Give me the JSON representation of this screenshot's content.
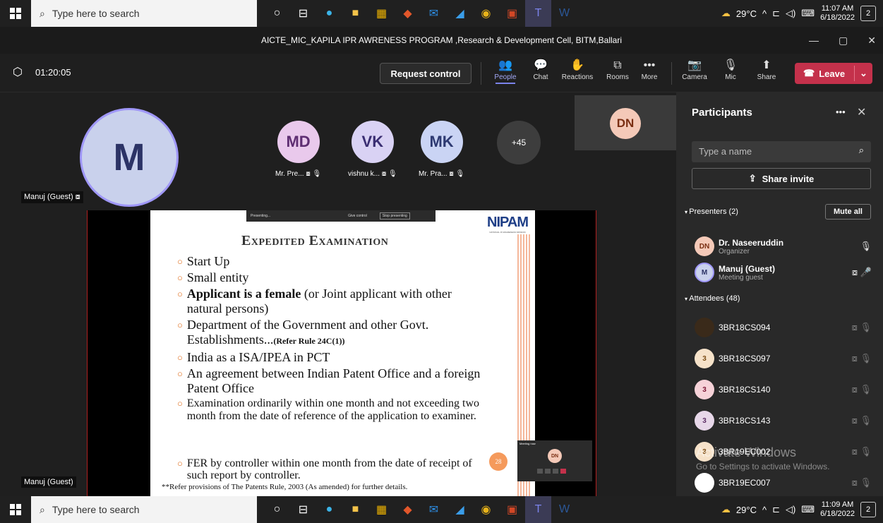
{
  "taskbar": {
    "search_placeholder": "Type here to search",
    "weather": "29°C",
    "time_top": "11:07 AM",
    "date_top": "6/18/2022",
    "time_bottom": "11:09 AM",
    "date_bottom": "6/18/2022",
    "notif_count": "2"
  },
  "window": {
    "title": "AICTE_MIC_KAPILA IPR AWRENESS PROGRAM ,Research & Development Cell, BITM,Ballari"
  },
  "meeting": {
    "elapsed": "01:20:05",
    "request_control": "Request control",
    "leave": "Leave",
    "tools": [
      "People",
      "Chat",
      "Reactions",
      "Rooms",
      "More"
    ],
    "controls": [
      "Camera",
      "Mic",
      "Share"
    ]
  },
  "stage": {
    "main_initial": "M",
    "main_label": "Manuj (Guest)",
    "gallery": [
      {
        "initials": "MD",
        "name": "Mr. Pre..."
      },
      {
        "initials": "VK",
        "name": "vishnu k..."
      },
      {
        "initials": "MK",
        "name": "Mr. Pra..."
      }
    ],
    "overflow": "+45",
    "dn_initials": "DN",
    "bottom_label": "Manuj (Guest)"
  },
  "slide": {
    "bar_presenting": "Presenting...",
    "bar_give": "Give control",
    "bar_stop": "Stop presenting",
    "logo": "NIPAM",
    "logo_sub": "NATIONAL IP AWARENESS MISSION",
    "title": "Expedited Examination",
    "bullets": [
      {
        "text": "Start Up"
      },
      {
        "text": "Small entity"
      },
      {
        "bold": "Applicant is a female",
        "text": " (or Joint applicant with other natural persons)"
      },
      {
        "text": "Department of the Government and other Govt. Establishments...",
        "small": "(Refer Rule 24C(1))"
      },
      {
        "text": "India as a ISA/IPEA in PCT"
      },
      {
        "text": "An agreement between Indian Patent Office and a foreign Patent Office"
      },
      {
        "text": "Examination ordinarily within one month and not exceeding two month from the date of reference of the application to examiner.",
        "size": "sm"
      },
      {
        "text": "FER by controller within one month from the date of receipt of such report by controller.",
        "size": "sm"
      }
    ],
    "footnote": "**Refer provisions of The Patents Rule, 2003 (As amended) for further details.",
    "page": "28",
    "mini_title": "Meeting now",
    "mini_initials": "DN"
  },
  "panel": {
    "title": "Participants",
    "search_placeholder": "Type a name",
    "share_invite": "Share invite",
    "presenters_header": "Presenters (2)",
    "mute_all": "Mute all",
    "presenters": [
      {
        "initials": "DN",
        "name": "Dr. Naseeruddin",
        "role": "Organizer"
      },
      {
        "initials": "M",
        "name": "Manuj (Guest)",
        "role": "Meeting guest"
      }
    ],
    "attendees_header": "Attendees (48)",
    "attendees": [
      {
        "initials": "",
        "name": "3BR18CS094"
      },
      {
        "initials": "3",
        "name": "3BR18CS097"
      },
      {
        "initials": "3",
        "name": "3BR18CS140"
      },
      {
        "initials": "3",
        "name": "3BR18CS143"
      },
      {
        "initials": "3",
        "name": "3BR19EC002"
      },
      {
        "initials": "",
        "name": "3BR19EC007"
      }
    ],
    "watermark1": "Activate Windows",
    "watermark2": "Go to Settings to activate Windows."
  }
}
